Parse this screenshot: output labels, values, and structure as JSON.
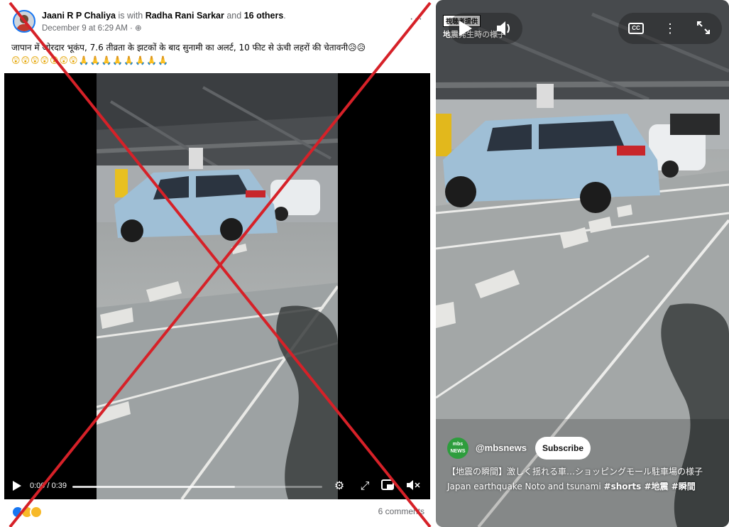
{
  "facebook_post": {
    "author": "Jaani R P Chaliya",
    "with_text": "is with",
    "tagged_person": "Radha Rani Sarkar",
    "and_text": "and",
    "others_count": "16 others",
    "timestamp": "December 9 at 6:29 AM",
    "privacy_icon": "globe-icon",
    "more_icon": "more-options-icon",
    "caption": "जापान में जोरदार भूकंप, 7.6 तीव्रता के झटकों के बाद सुनामी का अलर्ट, 10 फीट से ऊंची लहरों की चेतावनी😥😥",
    "caption_emojis": "😲😲😲😲😲😲😲🙏🙏🙏🙏🙏🙏🙏🙏",
    "video": {
      "time": "0:00 / 0:39",
      "buffered_fraction": 0.65
    },
    "reactions": [
      "like",
      "wow",
      "sad"
    ],
    "comments": "6 comments"
  },
  "youtube_short": {
    "badge": "視聴者提供",
    "overlay_text": "地震発生時の様子",
    "channel": "@mbsnews",
    "channel_logo_text": "mbs NEWS",
    "subscribe_label": "Subscribe",
    "title": "【地震の瞬間】激しく揺れる車…ショッピングモール駐車場の様子 Japan earthquake Noto and tsunami",
    "hashtags": "#shorts #地震 #瞬間"
  },
  "colors": {
    "fb_blue": "#1877f2",
    "cross_red": "#d62128",
    "car_blue": "#9fbfd6"
  }
}
